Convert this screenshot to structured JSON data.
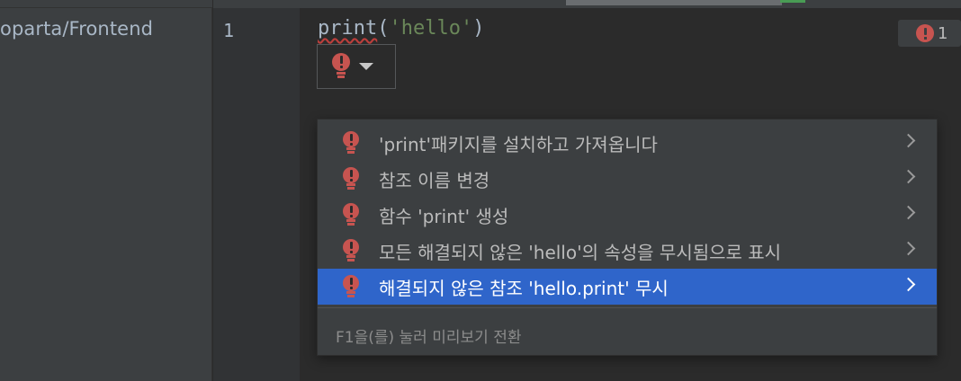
{
  "sidebar": {
    "project_path": "oparta/Frontend"
  },
  "editor": {
    "line_number": "1",
    "code": {
      "function": "print",
      "open": "(",
      "string": "'hello'",
      "close": ")"
    },
    "error_count": "1"
  },
  "intention_popup": {
    "items": [
      {
        "label": "'print'패키지를 설치하고 가져옵니다",
        "selected": false
      },
      {
        "label": "참조 이름 변경",
        "selected": false
      },
      {
        "label": "함수 'print' 생성",
        "selected": false
      },
      {
        "label": "모든 해결되지 않은 'hello'의 속성을 무시됨으로 표시",
        "selected": false
      },
      {
        "label": "해결되지 않은 참조 'hello.print' 무시",
        "selected": true
      }
    ],
    "hint": "F1을(를) 눌러 미리보기 전환"
  },
  "colors": {
    "error_red": "#c75450",
    "selection_blue": "#2f65ca",
    "string_green": "#6a8759"
  },
  "icons": {
    "bulb": "red-error-bulb-icon",
    "caret": "chevron-down-icon",
    "submenu": "chevron-right-icon",
    "error": "error-circle-icon"
  }
}
